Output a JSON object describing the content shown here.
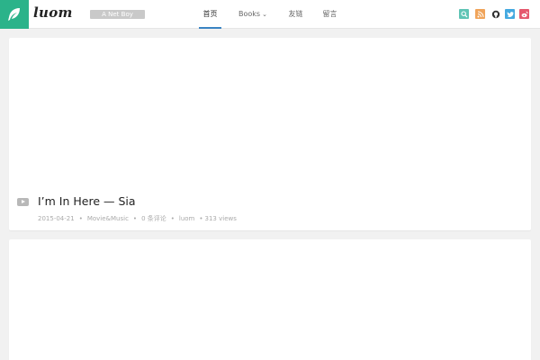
{
  "header": {
    "logo_text": "luom",
    "tagline": "A Net Boy",
    "accent": "#2bb38a",
    "nav": [
      {
        "label": "首页",
        "active": true
      },
      {
        "label": "Books",
        "active": false,
        "has_dropdown": true
      },
      {
        "label": "友链",
        "active": false
      },
      {
        "label": "留言",
        "active": false
      }
    ],
    "social": [
      {
        "name": "search-icon",
        "color": "#5fc4b5"
      },
      {
        "name": "rss-icon",
        "color": "#f0a45a"
      },
      {
        "name": "github-icon",
        "color": "#ffffff"
      },
      {
        "name": "twitter-icon",
        "color": "#44a9e0"
      },
      {
        "name": "weibo-icon",
        "color": "#e5596e"
      }
    ]
  },
  "post": {
    "title": "I’m In Here — Sia",
    "date": "2015-04-21",
    "category": "Movie&Music",
    "comments": "0 条评论",
    "author": "luom",
    "views": "313 views"
  }
}
